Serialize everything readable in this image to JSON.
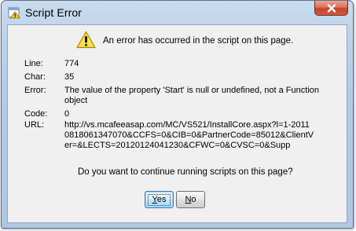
{
  "window": {
    "title": "Script Error",
    "icon": "script-error-page-icon",
    "close_icon": "close-icon"
  },
  "dialog": {
    "message": "An error has occurred in the script on this page.",
    "warning_icon": "warning-icon",
    "fields": [
      {
        "label": "Line:",
        "value": "774"
      },
      {
        "label": "Char:",
        "value": "35"
      },
      {
        "label": "Error:",
        "value": "The value of the property 'Start' is null or undefined, not a Function object"
      },
      {
        "label": "Code:",
        "value": "0"
      },
      {
        "label": "URL:",
        "value": "http://vs.mcafeeasap.com/MC/VS521/InstallCore.aspx?l=1-20110818061347070&CCFS=0&CIB=0&PartnerCode=85012&ClientVer=&LECTS=20120124041230&CFWC=0&CVSC=0&Supp"
      }
    ],
    "question": "Do you want to continue running scripts on this page?",
    "buttons": {
      "yes_rest": "es",
      "no_rest": "o",
      "yes_mnemonic": "Y",
      "no_mnemonic": "N"
    }
  },
  "colors": {
    "client_bg": "#f0f0f0",
    "close_red": "#c7432a",
    "frame_blue": "#b3cbe5"
  }
}
